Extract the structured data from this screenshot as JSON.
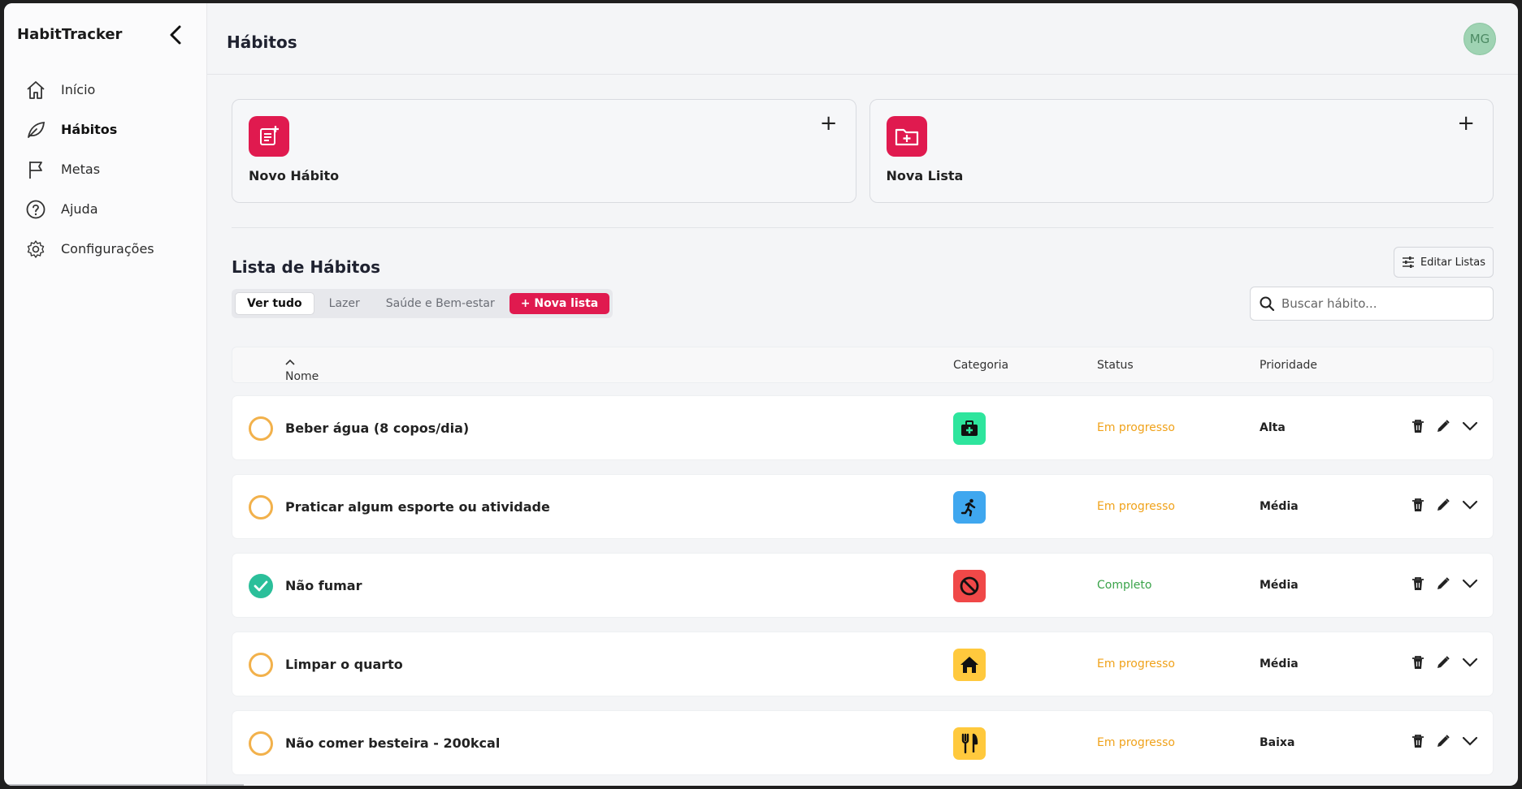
{
  "app": {
    "name": "HabitTracker"
  },
  "sidebar": {
    "items": [
      {
        "label": "Início",
        "icon": "home-icon",
        "active": false
      },
      {
        "label": "Hábitos",
        "icon": "leaf-icon",
        "active": true
      },
      {
        "label": "Metas",
        "icon": "flag-icon",
        "active": false
      },
      {
        "label": "Ajuda",
        "icon": "help-circle-icon",
        "active": false
      },
      {
        "label": "Configurações",
        "icon": "gear-icon",
        "active": false
      }
    ]
  },
  "header": {
    "title": "Hábitos",
    "avatar_initials": "MG"
  },
  "cards": [
    {
      "label": "Novo Hábito",
      "icon": "note-add-icon",
      "plus": "+"
    },
    {
      "label": "Nova Lista",
      "icon": "folder-add-icon",
      "plus": "+"
    }
  ],
  "list": {
    "title": "Lista de Hábitos",
    "edit_label": "Editar Listas",
    "tabs": [
      "Ver tudo",
      "Lazer",
      "Saúde e Bem-estar",
      "+ Nova lista"
    ],
    "search_placeholder": "Buscar hábito...",
    "columns": {
      "name": "Nome",
      "category": "Categoria",
      "status": "Status",
      "priority": "Prioridade"
    }
  },
  "habits": [
    {
      "name": "Beber água (8 copos/dia)",
      "category_icon": "medkit-icon",
      "category_color": "#2ee59d",
      "status": "Em progresso",
      "status_color": "#f0a21a",
      "priority": "Alta",
      "done": false
    },
    {
      "name": "Praticar algum esporte ou atividade",
      "category_icon": "running-icon",
      "category_color": "#3fa7ef",
      "status": "Em progresso",
      "status_color": "#f0a21a",
      "priority": "Média",
      "done": false
    },
    {
      "name": "Não fumar",
      "category_icon": "block-icon",
      "category_color": "#f04848",
      "status": "Completo",
      "status_color": "#3aa34a",
      "priority": "Média",
      "done": true
    },
    {
      "name": "Limpar o quarto",
      "category_icon": "house-icon",
      "category_color": "#ffc93d",
      "status": "Em progresso",
      "status_color": "#f0a21a",
      "priority": "Média",
      "done": false
    },
    {
      "name": "Não comer besteira - 200kcal",
      "category_icon": "fork-knife-icon",
      "category_color": "#ffc93d",
      "status": "Em progresso",
      "status_color": "#f0a21a",
      "priority": "Baixa",
      "done": false
    }
  ],
  "colors": {
    "accent": "#e01a4f",
    "check_pending": "#f2b14b",
    "check_done": "#2bbf9a"
  }
}
